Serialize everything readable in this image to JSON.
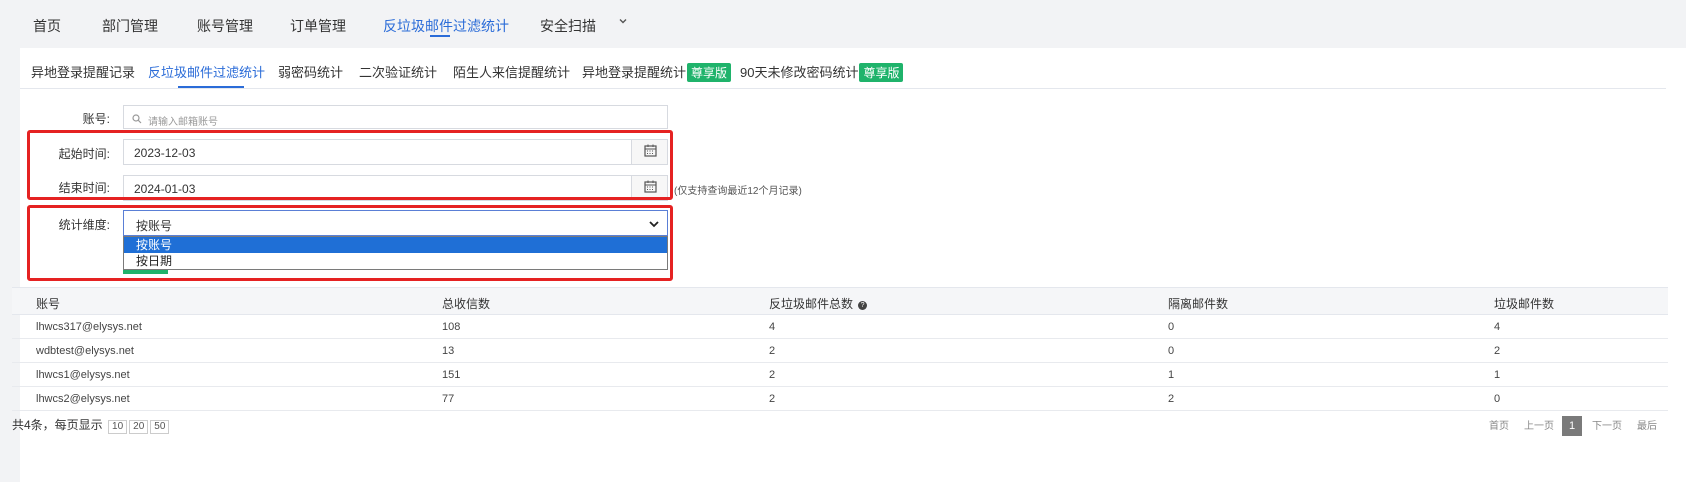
{
  "topnav": {
    "items": [
      "首页",
      "部门管理",
      "账号管理",
      "订单管理",
      "反垃圾邮件过滤统计",
      "安全扫描"
    ]
  },
  "subtabs": {
    "items": [
      "异地登录提醒记录",
      "反垃圾邮件过滤统计",
      "弱密码统计",
      "二次验证统计",
      "陌生人来信提醒统计",
      "异地登录提醒统计",
      "90天未修改密码统计"
    ],
    "badge": "尊享版"
  },
  "form": {
    "account_label": "账号:",
    "account_placeholder": "请输入邮箱账号",
    "start_label": "起始时间:",
    "start_value": "2023-12-03",
    "end_label": "结束时间:",
    "end_value": "2024-01-03",
    "range_hint": "(仅支持查询最近12个月记录)",
    "dimension_label": "统计维度:",
    "dimension_value": "按账号",
    "dimension_options": [
      "按账号",
      "按日期"
    ]
  },
  "table": {
    "headers": [
      "账号",
      "总收信数",
      "反垃圾邮件总数",
      "隔离邮件数",
      "垃圾邮件数"
    ],
    "rows": [
      [
        "lhwcs317@elysys.net",
        "108",
        "4",
        "0",
        "4"
      ],
      [
        "wdbtest@elysys.net",
        "13",
        "2",
        "0",
        "2"
      ],
      [
        "lhwcs1@elysys.net",
        "151",
        "2",
        "1",
        "1"
      ],
      [
        "lhwcs2@elysys.net",
        "77",
        "2",
        "2",
        "0"
      ]
    ]
  },
  "footer": {
    "summary": "共4条，每页显示",
    "page_sizes": [
      "10",
      "20",
      "50"
    ],
    "first": "首页",
    "prev": "上一页",
    "current": "1",
    "next": "下一页",
    "last": "最后"
  },
  "colors": {
    "accent": "#2b6cd8",
    "badge": "#1fb36b",
    "highlight": "#e52222",
    "option_selected": "#1f6fd6"
  }
}
